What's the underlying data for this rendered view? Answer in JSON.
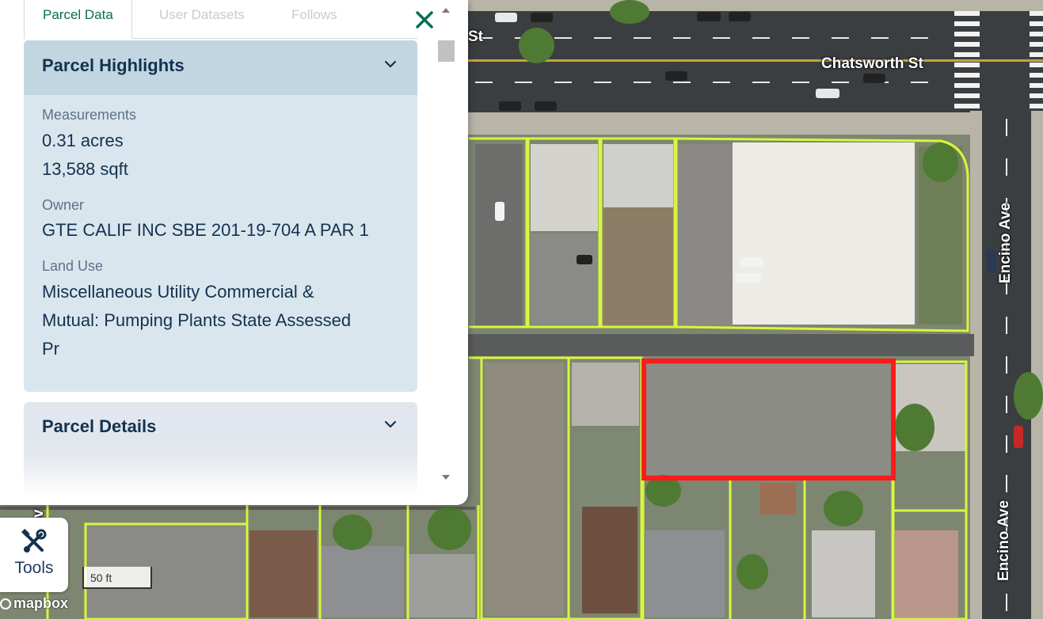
{
  "tabs": {
    "parcel_data": "Parcel Data",
    "user_datasets": "User Datasets",
    "follows": "Follows"
  },
  "highlights": {
    "title": "Parcel Highlights",
    "measurements_label": "Measurements",
    "acres": "0.31 acres",
    "sqft": "13,588 sqft",
    "owner_label": "Owner",
    "owner": "GTE CALIF INC SBE 201-19-704 A PAR 1",
    "land_use_label": "Land Use",
    "land_use_line1": "Miscellaneous Utility Commercial &",
    "land_use_line2": "Mutual: Pumping Plants State Assessed",
    "land_use_line3": "Pr"
  },
  "details": {
    "title": "Parcel Details"
  },
  "tools": {
    "label": "Tools"
  },
  "map": {
    "street_top": "Chatsworth St",
    "street_top_cut": "St",
    "street_right": "Encino Ave",
    "street_left_cut": "Av",
    "scale": "50 ft",
    "attribution": "mapbox"
  },
  "colors": {
    "accent": "#0a6e52",
    "parcel_outline": "#d9f53c",
    "selected_parcel": "#ff1a1a",
    "heading": "#13324f"
  },
  "icons": [
    "close-icon",
    "chevron-down-icon",
    "tools-icon",
    "scroll-up-icon",
    "scroll-down-icon",
    "mapbox-logo-icon"
  ]
}
